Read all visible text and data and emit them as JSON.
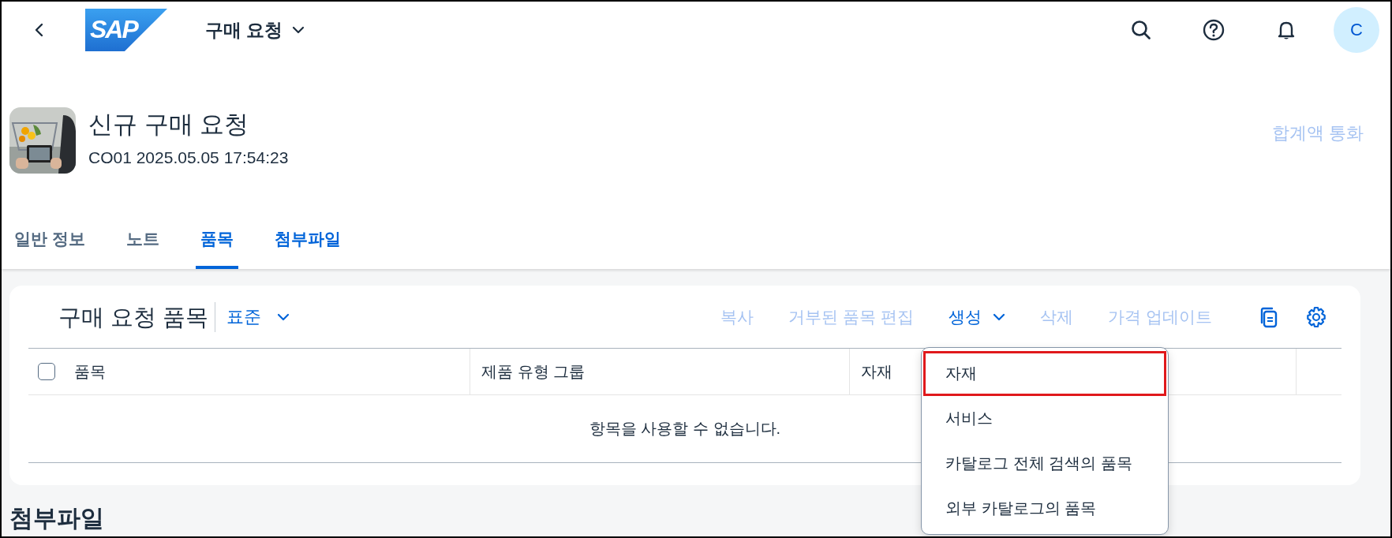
{
  "shell": {
    "logo": {
      "kind": "sap",
      "text": "SAP"
    },
    "title": "구매 요청",
    "avatar": "C"
  },
  "header": {
    "kind": "picture",
    "title": "신규 구매 요청",
    "subtitle": "CO01 2025.05.05 17:54:23",
    "currency_label": "합계액 통화"
  },
  "tabs": [
    {
      "label": "일반 정보",
      "selected": false,
      "hovered": false
    },
    {
      "label": "노트",
      "selected": false,
      "hovered": false
    },
    {
      "label": "품목",
      "selected": true,
      "hovered": false
    },
    {
      "label": "첨부파일",
      "selected": false,
      "hovered": true
    }
  ],
  "items_card": {
    "title": "구매 요청 품목",
    "variant": "표준",
    "actions": [
      {
        "label": "복사",
        "disabled": true,
        "kind": "button"
      },
      {
        "label": "거부된 품목 편집",
        "disabled": true,
        "kind": "button"
      },
      {
        "label": "생성",
        "disabled": false,
        "kind": "menu"
      },
      {
        "label": "삭제",
        "disabled": true,
        "kind": "button"
      },
      {
        "label": "가격 업데이트",
        "disabled": true,
        "kind": "button"
      }
    ],
    "table": {
      "select_all_checked": false,
      "columns": [
        "품목",
        "제품 유형 그룹",
        "자재"
      ],
      "no_data": "항목을 사용할 수 없습니다."
    }
  },
  "create_menu": {
    "items": [
      {
        "label": "자재",
        "selected": true
      },
      {
        "label": "서비스",
        "selected": false
      },
      {
        "label": "카탈로그 전체 검색의 품목",
        "selected": false
      },
      {
        "label": "외부 카탈로그의 품목",
        "selected": false
      }
    ]
  },
  "next_section": {
    "title": "첨부파일"
  }
}
